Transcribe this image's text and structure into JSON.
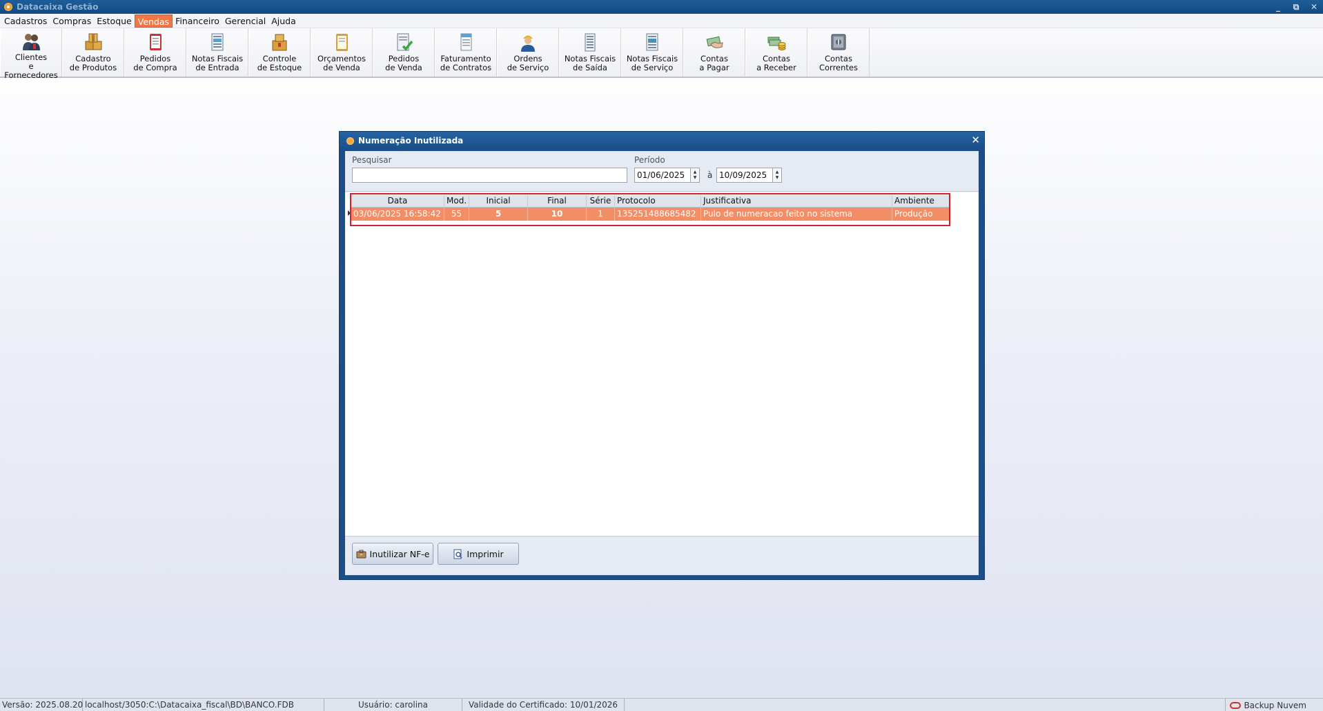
{
  "window": {
    "title": "Datacaixa Gestão",
    "controls": [
      "_",
      "⧉",
      "✕"
    ]
  },
  "menu": [
    {
      "label": "Cadastros",
      "active": false
    },
    {
      "label": "Compras",
      "active": false
    },
    {
      "label": "Estoque",
      "active": false
    },
    {
      "label": "Vendas",
      "active": true
    },
    {
      "label": "Financeiro",
      "active": false
    },
    {
      "label": "Gerencial",
      "active": false
    },
    {
      "label": "Ajuda",
      "active": false
    }
  ],
  "toolbar": [
    {
      "line1": "Clientes",
      "line2": "e Fornecedores",
      "icon": "people-icon"
    },
    {
      "line1": "Cadastro",
      "line2": "de Produtos",
      "icon": "boxes-icon"
    },
    {
      "line1": "Pedidos",
      "line2": "de Compra",
      "icon": "order-icon"
    },
    {
      "line1": "Notas Fiscais",
      "line2": "de Entrada",
      "icon": "invoice-in-icon"
    },
    {
      "line1": "Controle",
      "line2": "de Estoque",
      "icon": "stock-icon"
    },
    {
      "line1": "Orçamentos",
      "line2": "de Venda",
      "icon": "quote-icon"
    },
    {
      "line1": "Pedidos",
      "line2": "de Venda",
      "icon": "sales-order-icon"
    },
    {
      "line1": "Faturamento",
      "line2": "de Contratos",
      "icon": "contract-icon"
    },
    {
      "line1": "Ordens",
      "line2": "de Serviço",
      "icon": "worker-icon"
    },
    {
      "line1": "Notas Fiscais",
      "line2": "de Saída",
      "icon": "invoice-out-icon"
    },
    {
      "line1": "Notas Fiscais",
      "line2": "de Serviço",
      "icon": "invoice-service-icon"
    },
    {
      "line1": "Contas",
      "line2": "a Pagar",
      "icon": "pay-icon"
    },
    {
      "line1": "Contas",
      "line2": "a Receber",
      "icon": "receive-icon"
    },
    {
      "line1": "Contas",
      "line2": "Correntes",
      "icon": "safe-icon"
    }
  ],
  "dialog": {
    "title": "Numeração Inutilizada",
    "close": "✕",
    "search_label": "Pesquisar",
    "search_value": "",
    "period_label": "Período",
    "date_from": "01/06/2025",
    "date_sep": "à",
    "date_to": "10/09/2025",
    "columns": [
      "Data",
      "Mod.",
      "Inicial",
      "Final",
      "Série",
      "Protocolo",
      "Justificativa",
      "Ambiente"
    ],
    "rows": [
      [
        "03/06/2025 16:58:42",
        "55",
        "5",
        "10",
        "1",
        "135251488685482",
        "Pulo de numeracao feito no sistema",
        "Produção"
      ]
    ],
    "buttons": {
      "inutilizar": "Inutilizar NF-e",
      "imprimir": "Imprimir"
    }
  },
  "status": {
    "version": "Versão: 2025.08.20",
    "database": "localhost/3050:C:\\Datacaixa_fiscal\\BD\\BANCO.FDB",
    "user": "Usuário: carolina",
    "certificate": "Validade do Certificado: 10/01/2026",
    "backup": "Backup Nuvem"
  },
  "colors": {
    "accent": "#f07848",
    "row_selected": "#f28d66",
    "highlight_border": "#d4202a",
    "titlebar": "#1a4f87"
  }
}
